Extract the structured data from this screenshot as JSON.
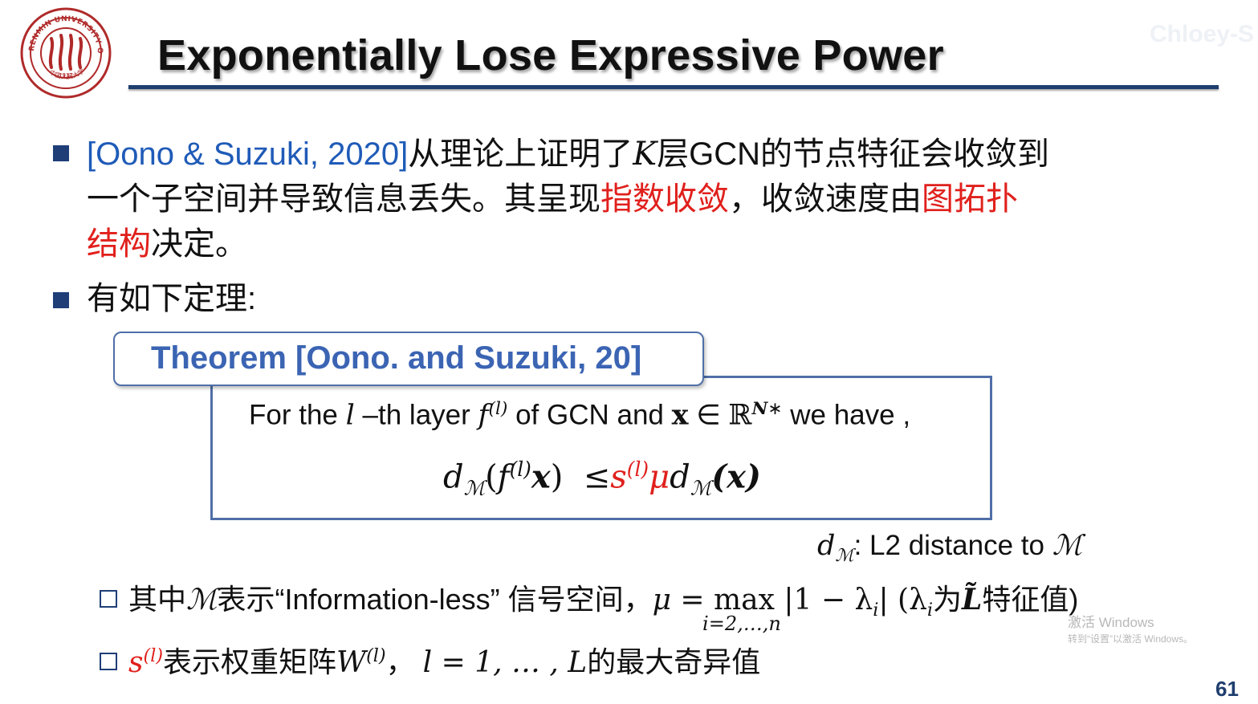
{
  "logo": {
    "arc_text": "RENMIN UNIVERSITY OF CHINA",
    "year": "1937",
    "bottom_text": "中国人民大学",
    "color": "#b02a2a"
  },
  "title": "Exponentially Lose Expressive Power",
  "watermark": "Chloey-S",
  "bullet1": {
    "cite": "[Oono & Suzuki, 2020]",
    "text_a": "从理论上证明了",
    "var_k": "K",
    "text_b": "层GCN的节点特征会收敛到",
    "line2_a": "一个子空间并导致信息丢失。其呈现",
    "red1": "指数收敛",
    "line2_b": "，收敛速度由",
    "red2a": "图拓扑",
    "red2b": "结构",
    "line3_b": "决定。"
  },
  "bullet2": {
    "text": "有如下定理:"
  },
  "theorem": {
    "title": "Theorem [Oono. and Suzuki, 20]",
    "line1": {
      "for_the": "For the ",
      "l": "l",
      "th_layer": " –th layer ",
      "f": "f",
      "sup_l": "(l)",
      "of_gcn": " of GCN and ",
      "x": "x",
      "in": " ∈ ",
      "R": "ℝ",
      "sup_n": "N",
      "star": "∗",
      "we_have": " we have ,"
    },
    "line2": {
      "d": "d",
      "M": "ℳ",
      "open": "(",
      "f": "f",
      "sup_l": "(l)",
      "x": "x",
      "close": ")",
      "leq": "≤",
      "s": "s",
      "s_sup": "(l)",
      "mu": "μ",
      "d2": "d",
      "M2": "ℳ",
      "x2": "(x)"
    }
  },
  "note": {
    "d": "d",
    "M": "ℳ",
    "text": ": L2 distance to ",
    "M_end": "ℳ"
  },
  "sub1": {
    "a": "其中",
    "M": "ℳ",
    "b": "表示“Information-less” 信号空间，",
    "mu_eq": "μ = ",
    "max": "max",
    "max_sub": "i=2,…,n",
    "abs": " |1 − λ",
    "abs_i": "i",
    "abs_end": "|",
    "paren_a": " (λ",
    "paren_i": "i",
    "paren_b": "为",
    "L": "L̃",
    "paren_c": "特征值)"
  },
  "sub2": {
    "s": "s",
    "s_sup": "(l)",
    "a": "表示权重矩阵",
    "W": "W",
    "W_sup": "(l)",
    "b": "，  ",
    "l_eq": "l = 1, … , L",
    "c": "的最大奇异值"
  },
  "windows": {
    "line1": "激活 Windows",
    "line2": "转到“设置”以激活 Windows。"
  },
  "page_number": "61"
}
